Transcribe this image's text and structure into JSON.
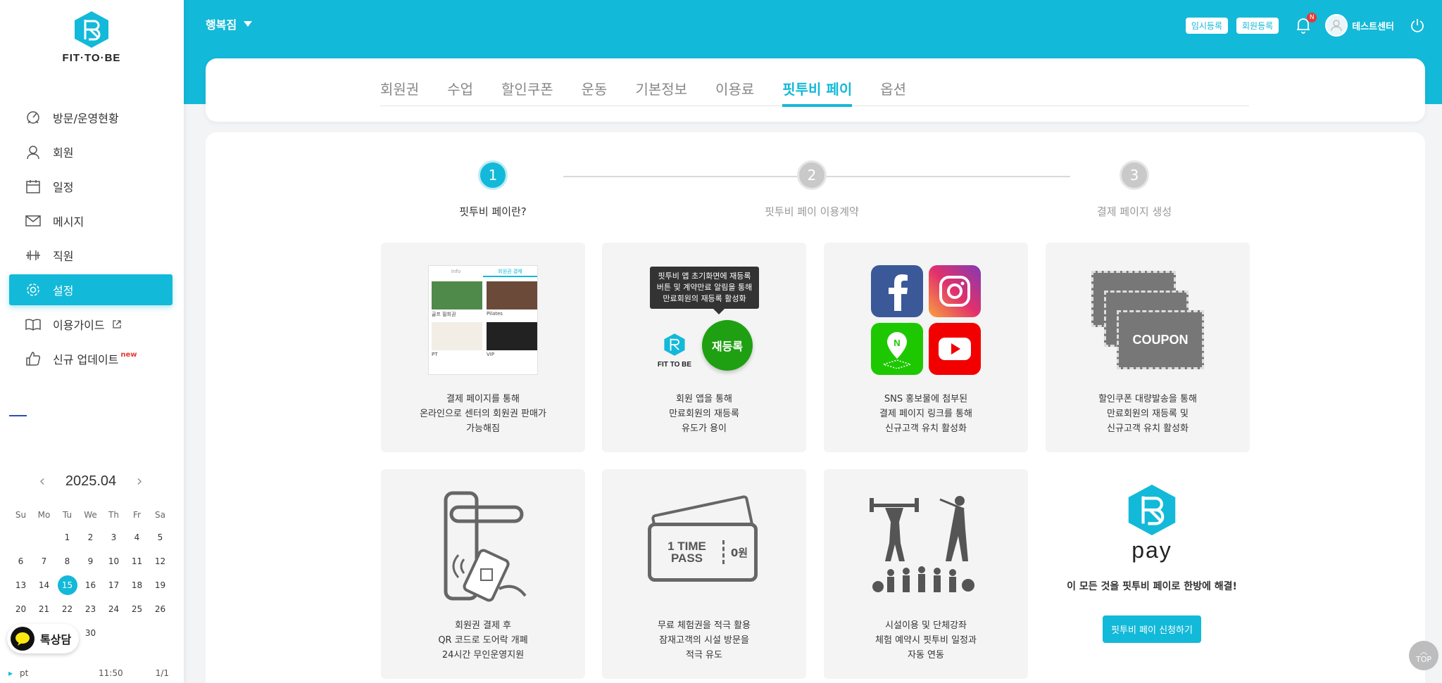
{
  "brand": {
    "logo_text": "FIT·TO·BE",
    "accent": "#13b9d8"
  },
  "sidebar": {
    "items": [
      {
        "label": "방문/운영현황",
        "icon": "dashboard-icon"
      },
      {
        "label": "회원",
        "icon": "user-icon"
      },
      {
        "label": "일정",
        "icon": "calendar-icon"
      },
      {
        "label": "메시지",
        "icon": "mail-icon"
      },
      {
        "label": "직원",
        "icon": "dumbbell-icon"
      },
      {
        "label": "설정",
        "icon": "gear-icon",
        "active": true
      },
      {
        "label": "이용가이드",
        "icon": "book-icon"
      },
      {
        "label": "신규 업데이트",
        "icon": "thumbs-up-icon",
        "badge": "new"
      }
    ]
  },
  "calendar": {
    "month": "2025.04",
    "weekdays": [
      "Su",
      "Mo",
      "Tu",
      "We",
      "Th",
      "Fr",
      "Sa"
    ],
    "days": [
      "",
      "",
      "1",
      "2",
      "3",
      "4",
      "5",
      "6",
      "7",
      "8",
      "9",
      "10",
      "11",
      "12",
      "13",
      "14",
      "15",
      "16",
      "17",
      "18",
      "19",
      "20",
      "21",
      "22",
      "23",
      "24",
      "25",
      "26",
      "27",
      "28",
      "29",
      "30"
    ],
    "today": "15"
  },
  "chat": {
    "label": "톡상담"
  },
  "schedule": {
    "name": "pt",
    "time": "11:50",
    "count": "1/1"
  },
  "header": {
    "gym": "행복짐",
    "buttons": [
      "임시등록",
      "회원등록"
    ],
    "notification_badge": "N",
    "user": "테스트센터"
  },
  "tabs": [
    "회원권",
    "수업",
    "할인쿠폰",
    "운동",
    "기본정보",
    "이용료",
    "핏투비 페이",
    "옵션"
  ],
  "active_tab": "핏투비 페이",
  "steps": [
    {
      "num": "1",
      "label": "핏투비 페이란?"
    },
    {
      "num": "2",
      "label": "핏투비 페이 이용계약"
    },
    {
      "num": "3",
      "label": "결제 페이지 생성"
    }
  ],
  "cards": [
    {
      "lines": [
        "결제 페이지를 통해",
        "온라인으로 센터의 회원권 판매가",
        "가능해짐"
      ],
      "thumb_tabs": [
        "Info",
        "회원권 결제"
      ],
      "thumb_labels": [
        "골프 필회권",
        "Pilates",
        "PT",
        "VIP"
      ]
    },
    {
      "lines": [
        "회원 앱을 통해",
        "만료회원의 재등록",
        "유도가 용이"
      ],
      "tooltip": [
        "핏투비 앱 초기화면에 재등록",
        "버튼 및 계약만료 알림을 통해",
        "만료회원의 재등록 활성화"
      ],
      "button": "재등록",
      "logo": "FIT TO BE"
    },
    {
      "lines": [
        "SNS 홍보물에 첨부된",
        "결제 페이지 링크를 통해",
        "신규고객 유치 활성화"
      ]
    },
    {
      "lines": [
        "할인쿠폰 대량발송을 통해",
        "만료회원의 재등록 및",
        "신규고객 유치 활성화"
      ],
      "coupon": "COUPON"
    },
    {
      "lines": [
        "회원권 결제 후",
        "QR 코드로 도어락 개폐",
        "24시간 무인운영지원"
      ]
    },
    {
      "lines": [
        "무료 체험권을 적극 활용",
        "잠재고객의 시설 방문을",
        "적극 유도"
      ],
      "ticket": [
        "1 TIME",
        "PASS",
        "0원"
      ]
    },
    {
      "lines": [
        "시설이용 및 단체강좌",
        "체험 예약시 핏투비 일정과",
        "자동 연동"
      ]
    }
  ],
  "pay": {
    "word": "pay",
    "text": "이 모든 것을 핏투비 페이로 한방에 해결!",
    "apply": "핏투비 페이 신청하기"
  },
  "top_button": "TOP"
}
